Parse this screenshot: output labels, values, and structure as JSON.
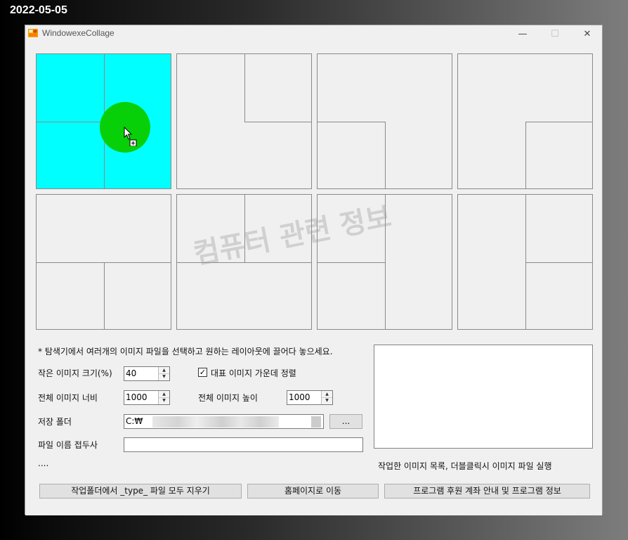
{
  "date_label": "2022-05-05",
  "window": {
    "title": "WindowexeCollage",
    "minimize_glyph": "—",
    "maximize_glyph": "☐",
    "close_glyph": "✕"
  },
  "layouts": {
    "count": 8,
    "selected_index": 0,
    "selected_color": "#00ffff",
    "drop_dot_color": "#08d008"
  },
  "watermark": "컴퓨터 관련 정보",
  "instructions": "* 탐색기에서 여러개의 이미지 파일을 선택하고 원하는 레이아웃에 끌어다 놓으세요.",
  "small_image_size": {
    "label": "작은 이미지 크기(%)",
    "value": "40"
  },
  "center_align": {
    "label": "대표 이미지 가운데 정렬",
    "checked": true,
    "check_glyph": "✓"
  },
  "total_width": {
    "label": "전체 이미지 너비",
    "value": "1000"
  },
  "total_height": {
    "label": "전체 이미지 높이",
    "value": "1000"
  },
  "save_folder": {
    "label": "저장 폴더",
    "value": "C:₩",
    "browse_label": "..."
  },
  "file_prefix": {
    "label": "파일 이름 접두사",
    "value": ""
  },
  "status_text": "....",
  "list_caption": "작업한 이미지 목록, 더블클릭시 이미지 파일 실행",
  "buttons": {
    "delete_type_files": "작업폴더에서 _type_ 파일 모두 지우기",
    "homepage": "홈페이지로 이동",
    "sponsor_info": "프로그램 후원 계좌 안내 및 프로그램 정보"
  },
  "icons": {
    "spin_up": "▲",
    "spin_down": "▼"
  }
}
